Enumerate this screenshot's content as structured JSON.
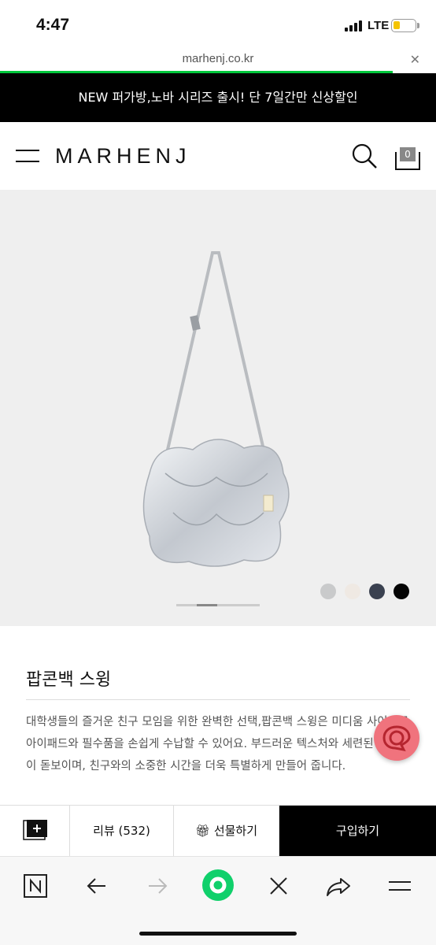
{
  "status": {
    "time": "4:47",
    "network": "LTE"
  },
  "browser": {
    "url": "marhenj.co.kr",
    "close": "✕",
    "progress_fraction": 0.9
  },
  "promo": {
    "text": "NEW 퍼가방,노바 시리즈 출시! 단 7일간만 신상할인"
  },
  "header": {
    "logo": "MARHENJ",
    "cart_count": "0"
  },
  "hero": {
    "swatch_colors": [
      "#c9cacb",
      "#efe9e3",
      "#3a4150",
      "#050505"
    ],
    "slide_index": 1
  },
  "product": {
    "title": "팝콘백 스윙",
    "description": "대학생들의 즐거운 친구 모임을 위한 완벽한 선택,팝콘백 스윙은 미디움 사이즈로 아이패드와 필수품을 손쉽게 수납할 수 있어요. 부드러운 텍스처와 세련된 디자인이 돋보이며, 친구와의 소중한 시간을 더욱 특별하게 만들어 줍니다."
  },
  "bottom_bar": {
    "review": "리뷰 (532)",
    "gift": "선물하기",
    "buy": "구입하기"
  }
}
